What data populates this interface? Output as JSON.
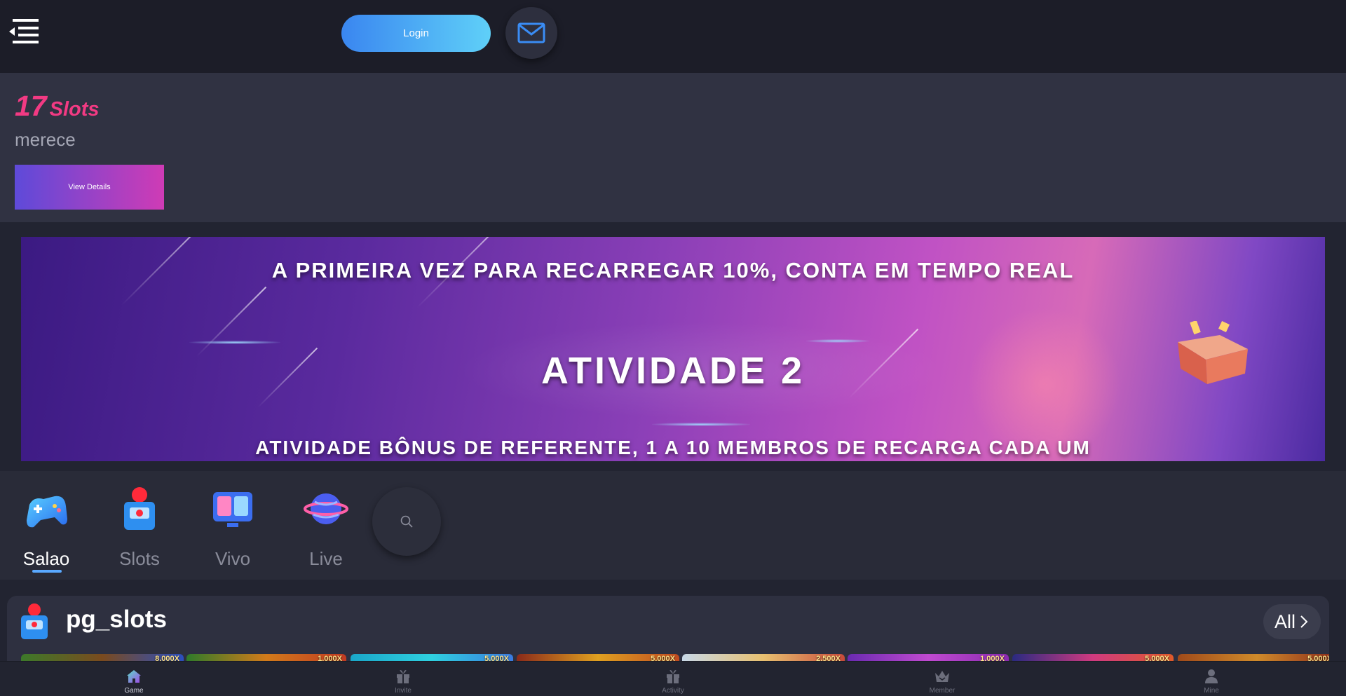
{
  "header": {
    "login_label": "Login"
  },
  "promo": {
    "count": "17",
    "category": "Slots",
    "subtitle": "merece",
    "view_details_label": "View Details"
  },
  "banner": {
    "line1": "A PRIMEIRA VEZ PARA RECARREGAR 10%, CONTA EM TEMPO REAL",
    "line2": "ATIVIDADE 2",
    "line3": "ATIVIDADE BÔNUS DE REFERENTE, 1 A 10 MEMBROS DE RECARGA CADA UM"
  },
  "categories": [
    {
      "label": "Salao",
      "icon": "gamepad-icon",
      "active": true
    },
    {
      "label": "Slots",
      "icon": "slot-machine-icon",
      "active": false
    },
    {
      "label": "Vivo",
      "icon": "live-tv-icon",
      "active": false
    },
    {
      "label": "Live",
      "icon": "globe-icon",
      "active": false
    }
  ],
  "section": {
    "title": "pg_slots",
    "all_label": "All",
    "thumb_tags": [
      "8,000X",
      "1,000X",
      "5,000X",
      "5,000X",
      "2,500X",
      "1,000X",
      "5,000X",
      "5,000X"
    ]
  },
  "bottom_nav": [
    {
      "label": "Game",
      "icon": "home-icon",
      "active": true
    },
    {
      "label": "Invite",
      "icon": "gift-icon",
      "active": false
    },
    {
      "label": "Activity",
      "icon": "gift-box-icon",
      "active": false
    },
    {
      "label": "Member",
      "icon": "crown-icon",
      "active": false
    },
    {
      "label": "Mine",
      "icon": "user-icon",
      "active": false
    }
  ],
  "colors": {
    "accent_pink": "#f23a83",
    "login_gradient": [
      "#3a86f0",
      "#5fd0f8"
    ],
    "view_gradient": [
      "#5e4ad9",
      "#cf3bb5"
    ],
    "active_underline": "#5aa9ff"
  }
}
